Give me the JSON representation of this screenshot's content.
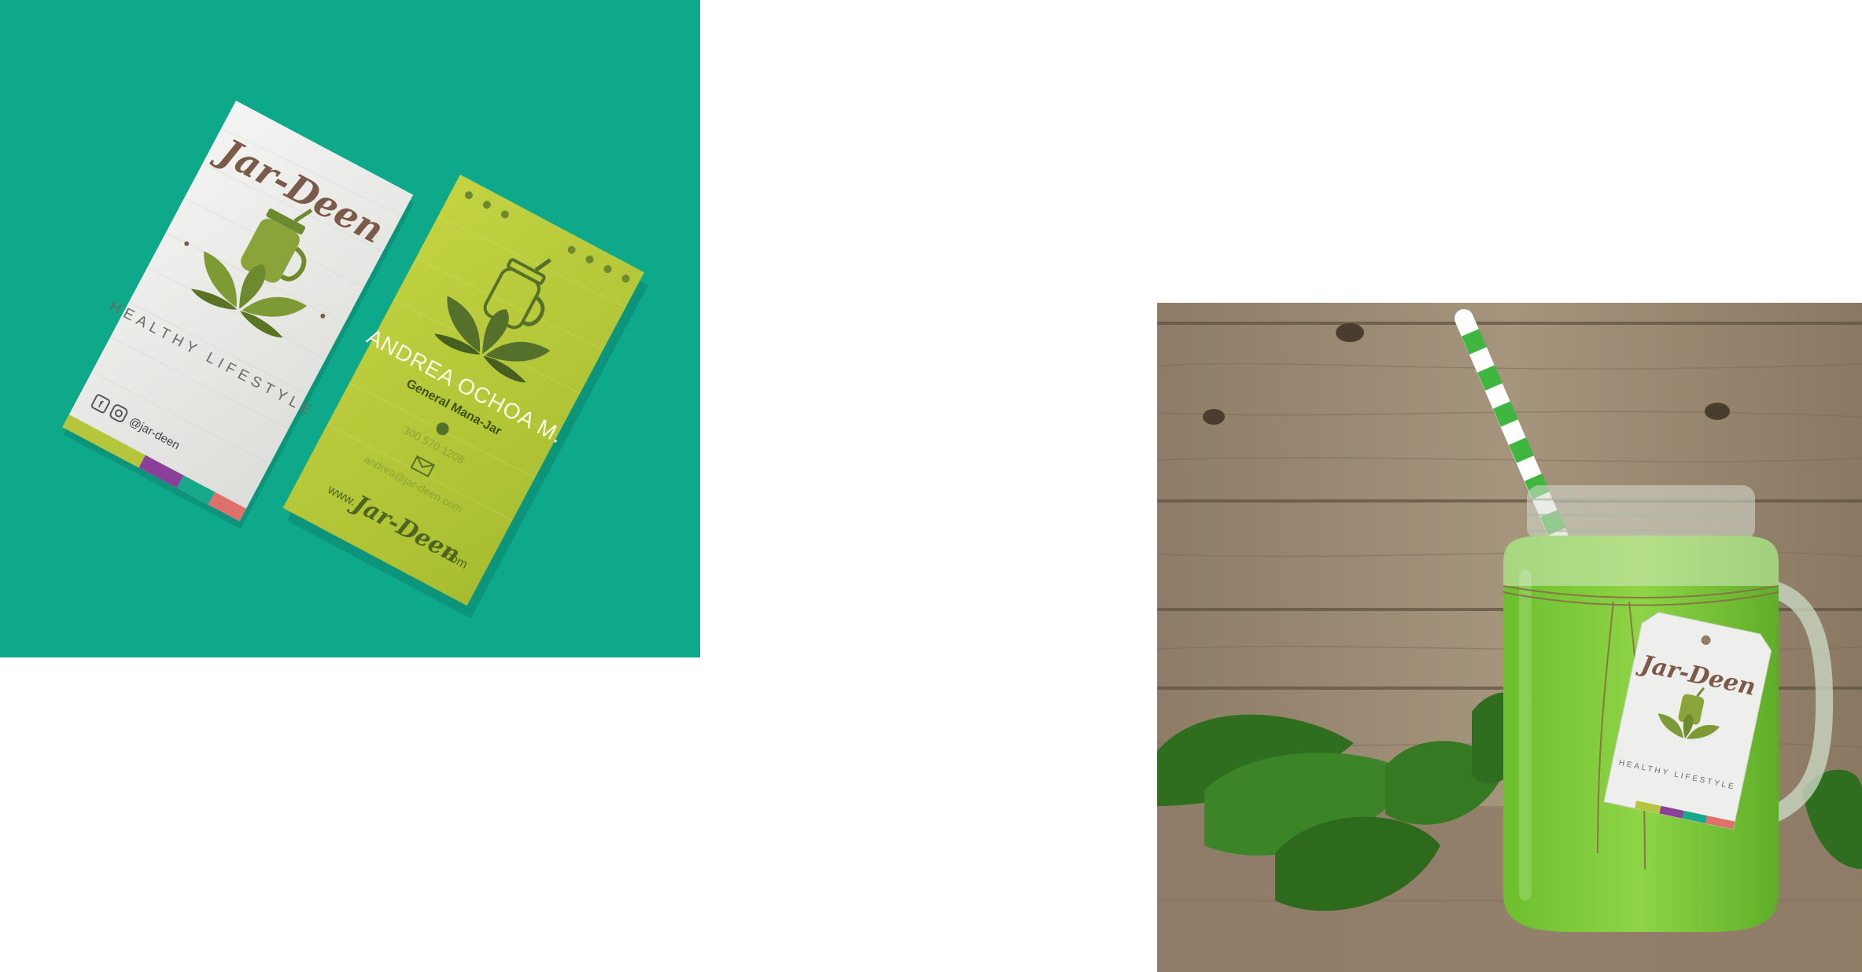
{
  "brand": {
    "name": "Jar-Deen",
    "tagline": "HEALTHY LIFESTYLE",
    "social_handle": "@jar-deen",
    "web_prefix": "www.",
    "web_suffix": ".com"
  },
  "card_back": {
    "person_name": "ANDREA OCHOA M.",
    "person_title": "General Mana-Jar",
    "phone": "300 570 1208",
    "email": "andrea@jar-deen.com"
  },
  "tag": {
    "brand": "Jar-Deen",
    "tagline": "HEALTHY LIFESTYLE"
  },
  "colors": {
    "teal_background": "#0ea88a",
    "card_green": "#b3c73a",
    "logo_green": "#6e8a2e",
    "script_brown": "#7b5a4a",
    "smoothie_green": "#7cc83a",
    "wood": "#9a8a74"
  },
  "icons": [
    "facebook-icon",
    "instagram-icon",
    "phone-icon",
    "mail-icon",
    "jar-icon",
    "lotus-icon",
    "straw-icon"
  ]
}
